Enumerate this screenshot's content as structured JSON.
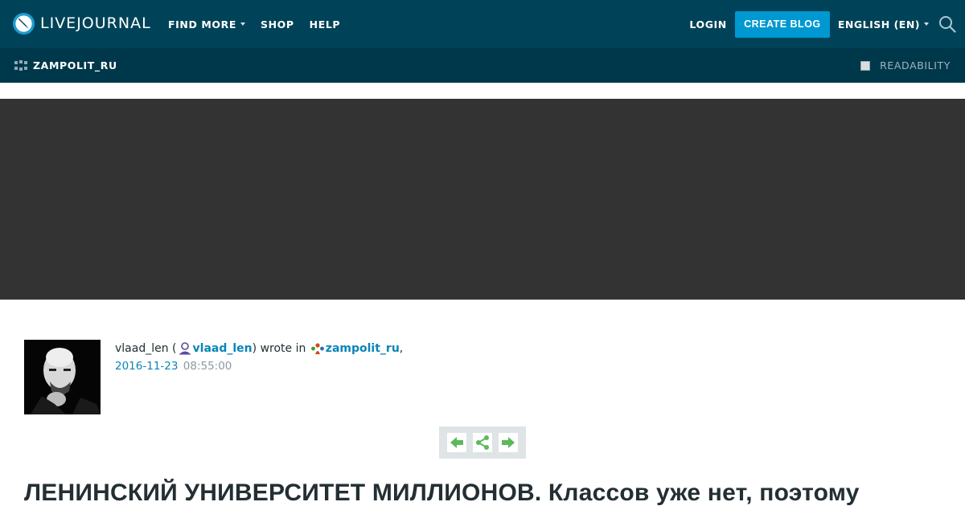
{
  "header": {
    "logo_text": "LIVEJOURNAL",
    "nav": [
      {
        "label": "FIND MORE",
        "has_dropdown": true
      },
      {
        "label": "SHOP",
        "has_dropdown": false
      },
      {
        "label": "HELP",
        "has_dropdown": false
      }
    ],
    "login_label": "LOGIN",
    "create_blog_label": "CREATE BLOG",
    "language_label": "ENGLISH (EN)",
    "icons": {
      "logo": "livejournal-logo-icon",
      "search": "search-icon"
    }
  },
  "subbar": {
    "journal_name": "ZAMPOLIT_RU",
    "readability_label": "READABILITY",
    "readability_checked": false,
    "icons": {
      "community": "community-icon"
    }
  },
  "entry": {
    "author_plain": "vlaad_len",
    "author_link": "vlaad_len",
    "wrote_in_text": "wrote in",
    "community_link": "zampolit_ru",
    "date": "2016-11-23",
    "time": "08:55:00",
    "title": "ЛЕНИНСКИЙ УНИВЕРСИТЕТ МИЛЛИОНОВ. Классов уже нет, поэтому",
    "controls": [
      "previous-entry-icon",
      "share-icon",
      "next-entry-icon"
    ]
  },
  "colors": {
    "header_bg": "#004359",
    "subbar_bg": "#00384b",
    "accent": "#0098d0",
    "link": "#0a85b8",
    "banner_bg": "#333333",
    "control_green": "#5cb85c"
  }
}
